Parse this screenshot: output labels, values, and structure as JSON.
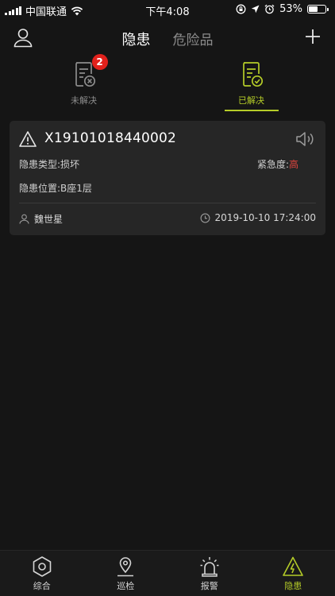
{
  "status_bar": {
    "carrier": "中国联通",
    "time": "下午4:08",
    "battery": "53%",
    "battery_level": 0.53
  },
  "header": {
    "tabs": [
      {
        "label": "隐患",
        "active": true
      },
      {
        "label": "危险品",
        "active": false
      }
    ],
    "icons": {
      "left": "user-icon",
      "right": "plus-icon"
    }
  },
  "subtabs": [
    {
      "label": "未解决",
      "badge": "2",
      "icon": "document-x-icon",
      "active": false
    },
    {
      "label": "已解决",
      "icon": "document-check-icon",
      "active": true
    }
  ],
  "hazard_card": {
    "id": "X19101018440002",
    "type_label": "隐患类型:",
    "type_value": "损坏",
    "urgency_label": "紧急度:",
    "urgency_value": "高",
    "location_label": "隐患位置:",
    "location_value": "B座1层",
    "reporter": "魏世星",
    "timestamp": "2019-10-10 17:24:00"
  },
  "bottom_nav": [
    {
      "label": "综合",
      "icon": "hexagon-icon",
      "active": false
    },
    {
      "label": "巡检",
      "icon": "map-pin-icon",
      "active": false
    },
    {
      "label": "报警",
      "icon": "alarm-siren-icon",
      "active": false
    },
    {
      "label": "隐患",
      "icon": "warning-bolt-icon",
      "active": true
    }
  ],
  "colors": {
    "background": "#151515",
    "card": "#262626",
    "accent": "#b5cc28",
    "danger": "#e2211c",
    "urgency_high": "#e0453f"
  }
}
